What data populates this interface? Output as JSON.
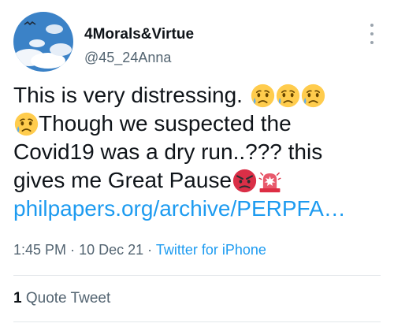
{
  "author": {
    "name": "4Morals&Virtue",
    "handle": "@45_24Anna"
  },
  "tweet": {
    "line1": "This is very distressing.",
    "line2": "Though we suspected the",
    "line3": "Covid19 was a dry run..??? this",
    "line4": "gives me Great Pause",
    "link": "philpapers.org/archive/PERPFA…",
    "emoji_names": [
      "sad-but-relieved-face",
      "sad-but-relieved-face",
      "sad-but-relieved-face",
      "sad-but-relieved-face",
      "angry-face",
      "police-light"
    ]
  },
  "meta": {
    "time": "1:45 PM",
    "separator": "·",
    "date": "10 Dec 21",
    "source": "Twitter for iPhone"
  },
  "engagement": {
    "quote_count": "1",
    "quote_label": "Quote Tweet"
  },
  "colors": {
    "text": "#0f1419",
    "secondary": "#536471",
    "link": "#1d9bf0",
    "divider": "#e3e7ea"
  }
}
